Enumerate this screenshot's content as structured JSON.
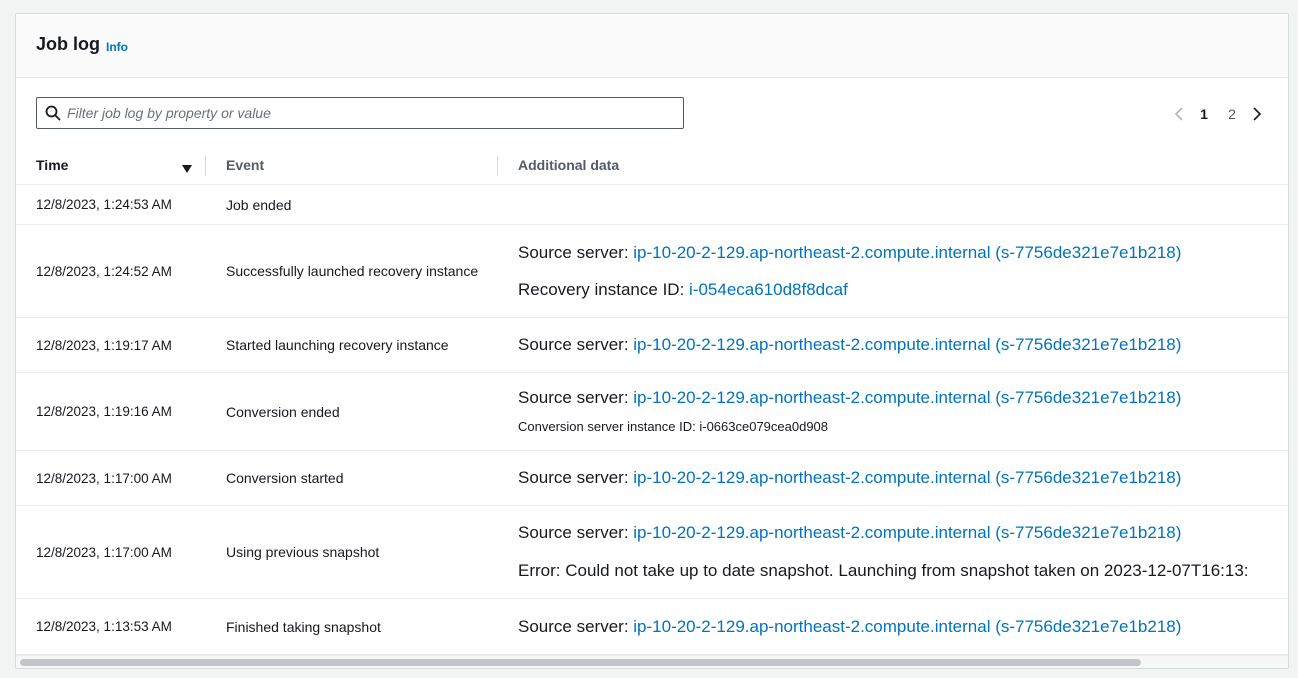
{
  "panel": {
    "title": "Job log",
    "info_label": "Info"
  },
  "filter": {
    "placeholder": "Filter job log by property or value",
    "value": ""
  },
  "pagination": {
    "pages": [
      "1",
      "2"
    ],
    "current": "1"
  },
  "table": {
    "columns": [
      "Time",
      "Event",
      "Additional data"
    ],
    "rows": [
      {
        "time": "12/8/2023, 1:24:53 AM",
        "event": "Job ended",
        "data": []
      },
      {
        "time": "12/8/2023, 1:24:52 AM",
        "event": "Successfully launched recovery instance",
        "data": [
          {
            "key": "Source server: ",
            "link": "ip-10-20-2-129.ap-northeast-2.compute.internal (s-7756de321e7e1b218)"
          },
          {
            "key": "Recovery instance ID: ",
            "link": "i-054eca610d8f8dcaf"
          }
        ]
      },
      {
        "time": "12/8/2023, 1:19:17 AM",
        "event": "Started launching recovery instance",
        "data": [
          {
            "key": "Source server: ",
            "link": "ip-10-20-2-129.ap-northeast-2.compute.internal (s-7756de321e7e1b218)"
          }
        ]
      },
      {
        "time": "12/8/2023, 1:19:16 AM",
        "event": "Conversion ended",
        "data": [
          {
            "key": "Source server: ",
            "link": "ip-10-20-2-129.ap-northeast-2.compute.internal (s-7756de321e7e1b218)"
          },
          {
            "small": "Conversion server instance ID: i-0663ce079cea0d908"
          }
        ]
      },
      {
        "time": "12/8/2023, 1:17:00 AM",
        "event": "Conversion started",
        "data": [
          {
            "key": "Source server: ",
            "link": "ip-10-20-2-129.ap-northeast-2.compute.internal (s-7756de321e7e1b218)"
          }
        ]
      },
      {
        "time": "12/8/2023, 1:17:00 AM",
        "event": "Using previous snapshot",
        "data": [
          {
            "key": "Source server: ",
            "link": "ip-10-20-2-129.ap-northeast-2.compute.internal (s-7756de321e7e1b218)"
          },
          {
            "text": "Error: Could not take up to date snapshot. Launching from snapshot taken on 2023-12-07T16:13:"
          }
        ]
      },
      {
        "time": "12/8/2023, 1:13:53 AM",
        "event": "Finished taking snapshot",
        "data": [
          {
            "key": "Source server: ",
            "link": "ip-10-20-2-129.ap-northeast-2.compute.internal (s-7756de321e7e1b218)"
          }
        ]
      }
    ]
  },
  "colors": {
    "link": "#0073bb",
    "text": "#16191f",
    "muted": "#545b64"
  },
  "icons": {
    "search": "search-icon",
    "sort": "sort-descending-icon",
    "prev": "chevron-left-icon",
    "next": "chevron-right-icon"
  }
}
